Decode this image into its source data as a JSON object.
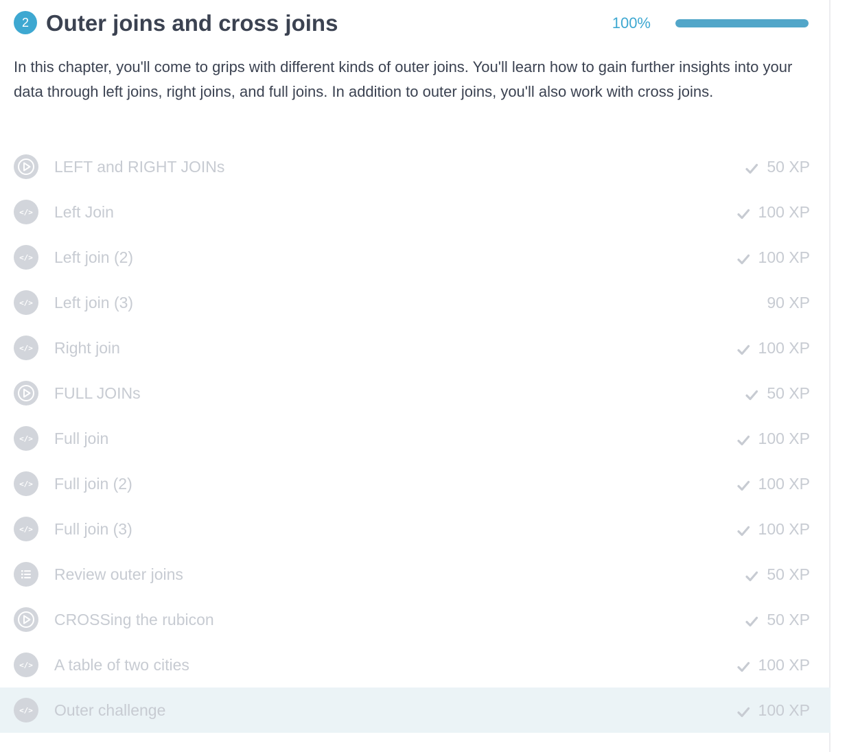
{
  "chapter": {
    "number": "2",
    "title": "Outer joins and cross joins",
    "progress_percent": 100,
    "progress_label": "100%",
    "description": "In this chapter, you'll come to grips with different kinds of outer joins. You'll learn how to gain further insights into your data through left joins, right joins, and full joins. In addition to outer joins, you'll also work with cross joins."
  },
  "colors": {
    "accent": "#3ea8d1",
    "progress_fill": "#52a6c9",
    "icon_bg": "#d2d5db",
    "muted_text": "#c7cbd2",
    "active_row_bg": "#ebf3f6",
    "title_text": "#3b4251"
  },
  "exercises": [
    {
      "title": "LEFT and RIGHT JOINs",
      "xp": "50 XP",
      "icon": "play-icon",
      "completed": true,
      "active": false
    },
    {
      "title": "Left Join",
      "xp": "100 XP",
      "icon": "code-icon",
      "completed": true,
      "active": false
    },
    {
      "title": "Left join (2)",
      "xp": "100 XP",
      "icon": "code-icon",
      "completed": true,
      "active": false
    },
    {
      "title": "Left join (3)",
      "xp": "90 XP",
      "icon": "code-icon",
      "completed": false,
      "active": false
    },
    {
      "title": "Right join",
      "xp": "100 XP",
      "icon": "code-icon",
      "completed": true,
      "active": false
    },
    {
      "title": "FULL JOINs",
      "xp": "50 XP",
      "icon": "play-icon",
      "completed": true,
      "active": false
    },
    {
      "title": "Full join",
      "xp": "100 XP",
      "icon": "code-icon",
      "completed": true,
      "active": false
    },
    {
      "title": "Full join (2)",
      "xp": "100 XP",
      "icon": "code-icon",
      "completed": true,
      "active": false
    },
    {
      "title": "Full join (3)",
      "xp": "100 XP",
      "icon": "code-icon",
      "completed": true,
      "active": false
    },
    {
      "title": "Review outer joins",
      "xp": "50 XP",
      "icon": "list-icon",
      "completed": true,
      "active": false
    },
    {
      "title": "CROSSing the rubicon",
      "xp": "50 XP",
      "icon": "play-icon",
      "completed": true,
      "active": false
    },
    {
      "title": "A table of two cities",
      "xp": "100 XP",
      "icon": "code-icon",
      "completed": true,
      "active": false
    },
    {
      "title": "Outer challenge",
      "xp": "100 XP",
      "icon": "code-icon",
      "completed": true,
      "active": true
    }
  ]
}
